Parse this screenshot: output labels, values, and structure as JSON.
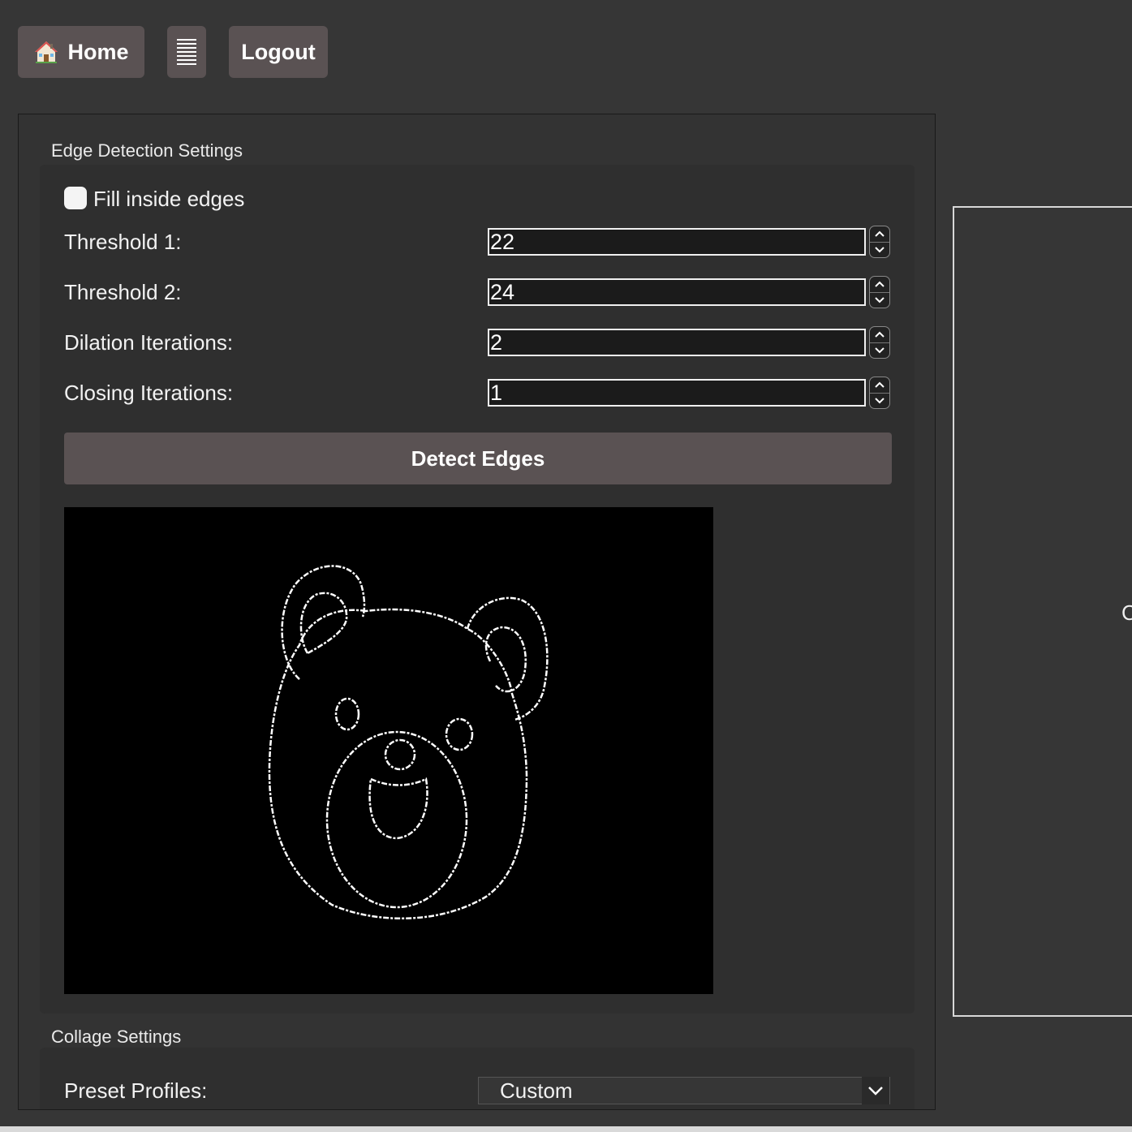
{
  "toolbar": {
    "home_label": "Home",
    "logout_label": "Logout"
  },
  "edge_detection": {
    "title": "Edge Detection Settings",
    "fill_label": "Fill inside edges",
    "fill_checked": false,
    "fields": [
      {
        "label": "Threshold 1:",
        "value": "22"
      },
      {
        "label": "Threshold 2:",
        "value": "24"
      },
      {
        "label": "Dilation Iterations:",
        "value": "2"
      },
      {
        "label": "Closing Iterations:",
        "value": "1"
      }
    ],
    "detect_label": "Detect Edges"
  },
  "collage": {
    "title": "Collage Settings",
    "preset_label": "Preset Profiles:",
    "preset_value": "Custom"
  },
  "right_panel": {
    "partial_text": "C"
  }
}
